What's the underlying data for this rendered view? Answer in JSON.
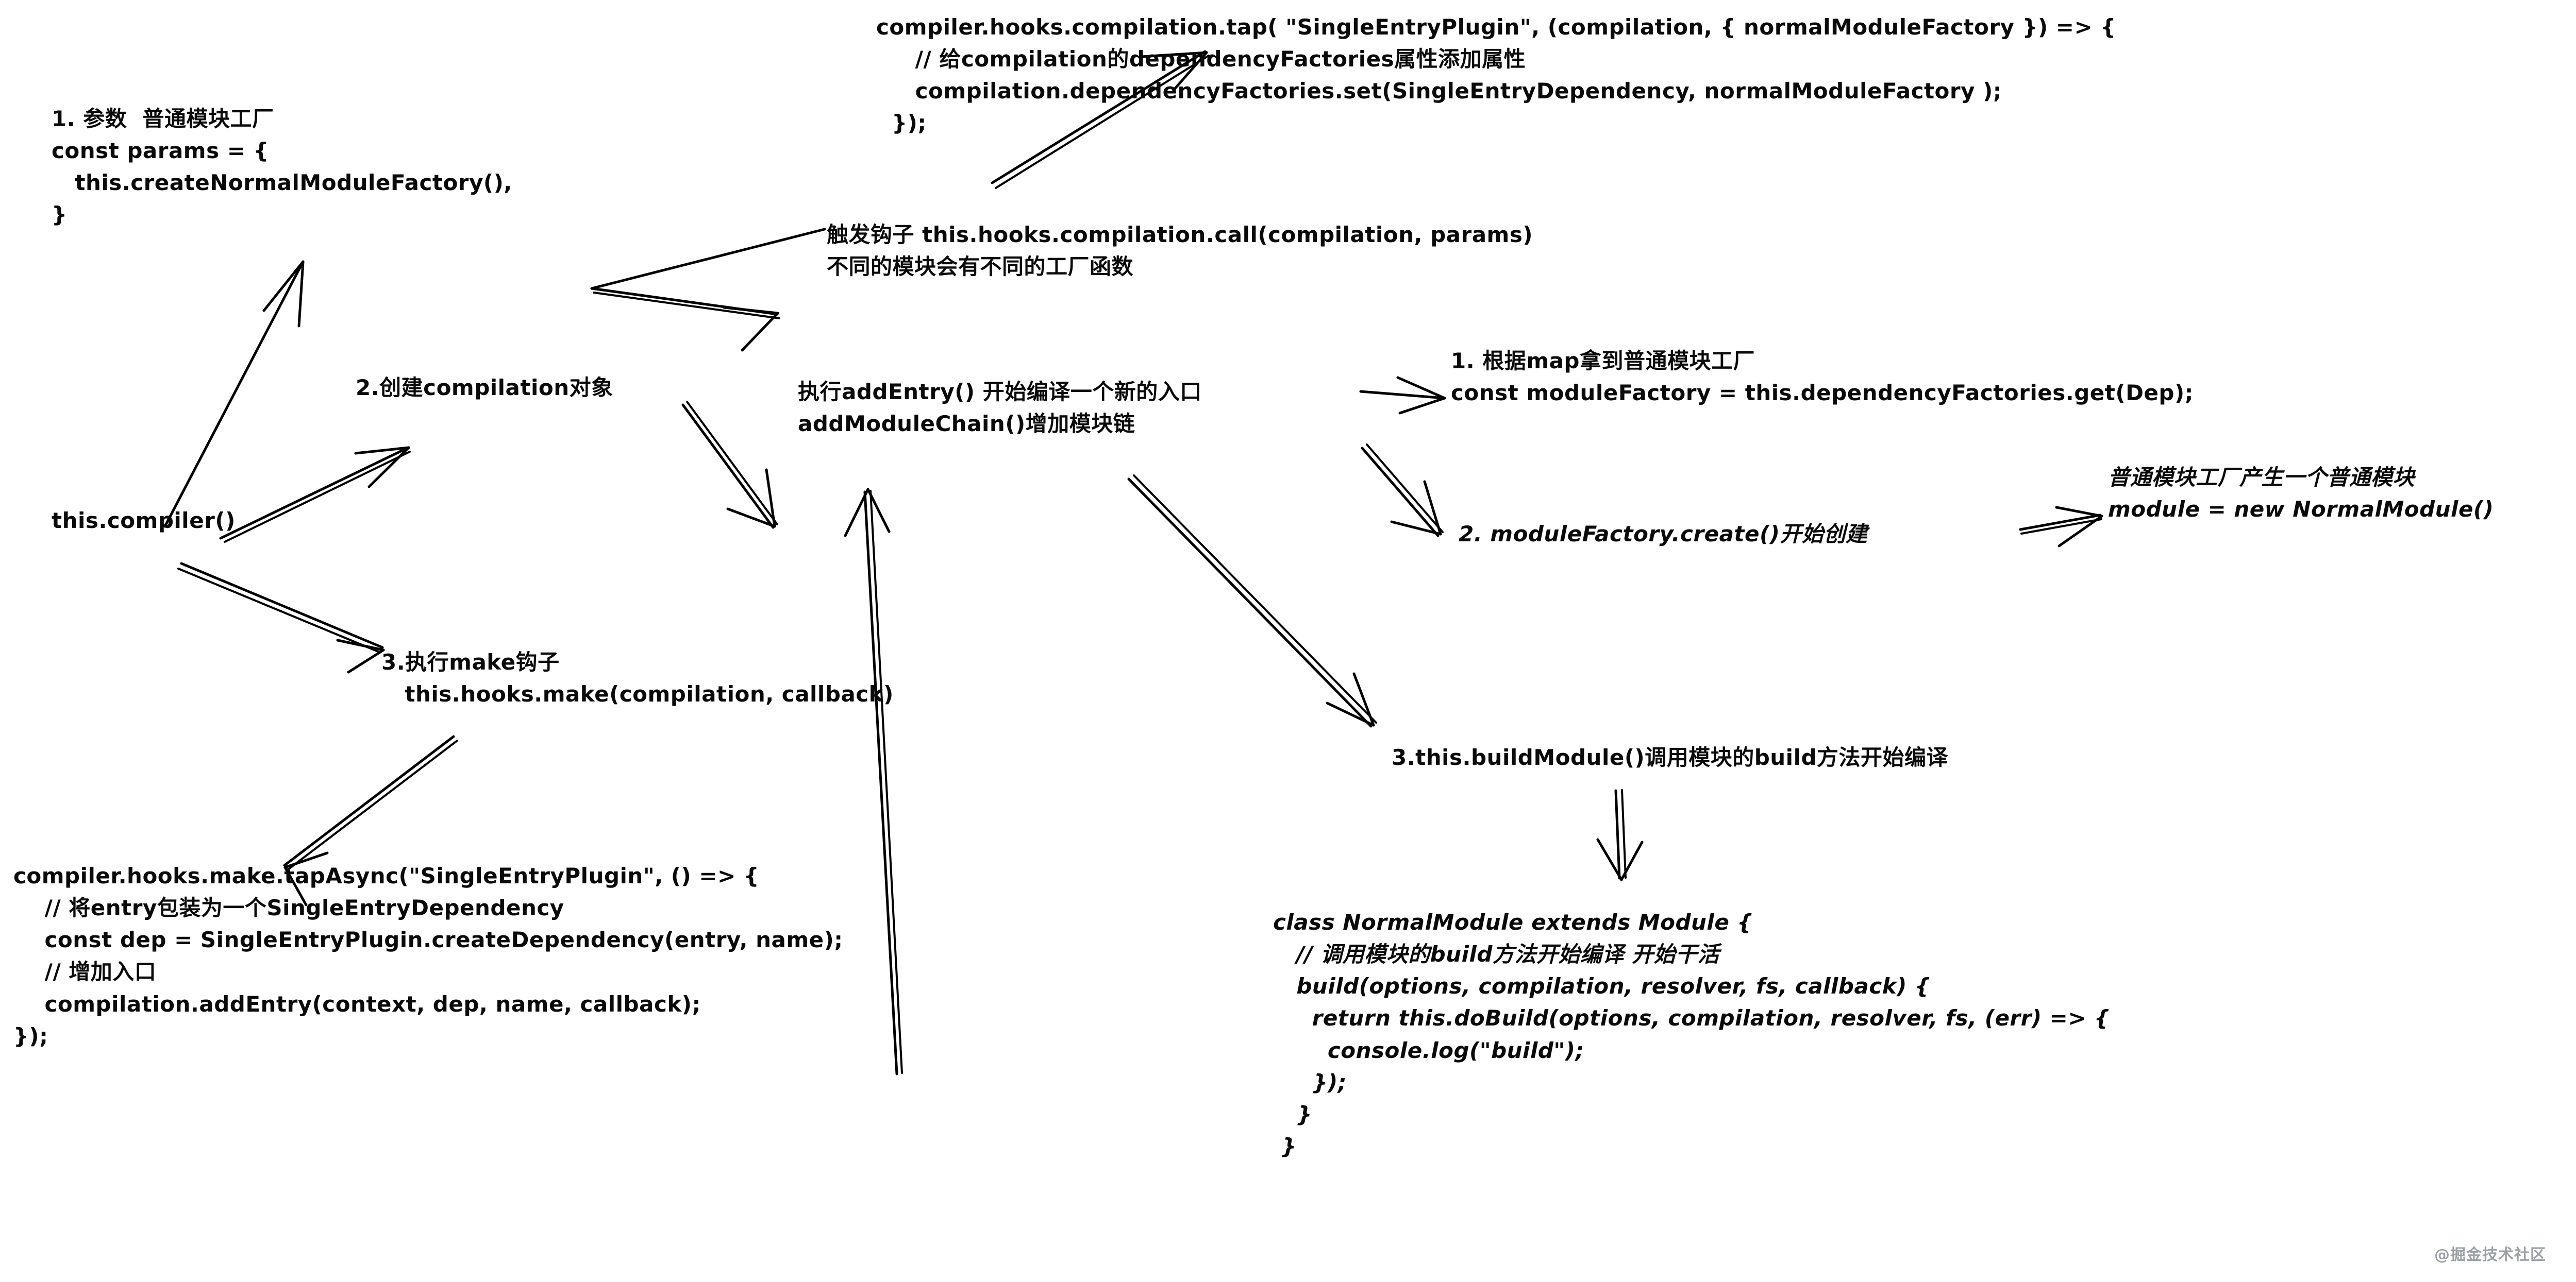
{
  "diagram": {
    "title": "webpack compiler / compilation 编译流程手绘图",
    "watermark": "@掘金技术社区",
    "nodes": {
      "params_block": "1. 参数  普通模块工厂\nconst params = {\n   this.createNormalModuleFactory(),\n}",
      "compilation_tap_block": "compiler.hooks.compilation.tap( \"SingleEntryPlugin\", (compilation, { normalModuleFactory }) => {\n     // 给compilation的dependencyFactories属性添加属性\n     compilation.dependencyFactories.set(SingleEntryDependency, normalModuleFactory );\n  });",
      "hook_call_block": "触发钩子 this.hooks.compilation.call(compilation, params)\n不同的模块会有不同的工厂函数",
      "create_compilation": "2.创建compilation对象",
      "this_compiler": "this.compiler()",
      "add_entry_block": "执行addEntry() 开始编译一个新的入口\naddModuleChain()增加模块链",
      "make_hook_block": "3.执行make钩子\n   this.hooks.make(compilation, callback)",
      "module_factory_block": "1. 根据map拿到普通模块工厂\nconst moduleFactory = this.dependencyFactories.get(Dep);",
      "module_factory_create": "2. moduleFactory.create()开始创建",
      "normal_module_block": "普通模块工厂产生一个普通模块\nmodule = new NormalModule()",
      "build_module": "3.this.buildModule()调用模块的build方法开始编译",
      "tap_async_block": "compiler.hooks.make.tapAsync(\"SingleEntryPlugin\", () => {\n    // 将entry包装为一个SingleEntryDependency\n    const dep = SingleEntryPlugin.createDependency(entry, name);\n    // 增加入口\n    compilation.addEntry(context, dep, name, callback);\n});",
      "normal_module_class_block": "class NormalModule extends Module {\n   // 调用模块的build方法开始编译 开始干活\n   build(options, compilation, resolver, fs, callback) {\n     return this.doBuild(options, compilation, resolver, fs, (err) => {\n       console.log(\"build\");\n     });\n   }\n }"
    },
    "edges": [
      {
        "name": "compiler-to-params",
        "from": "this.compiler()",
        "to": "1. 参数 普通模块工厂"
      },
      {
        "name": "compiler-to-create-compilation",
        "from": "this.compiler()",
        "to": "2.创建compilation对象"
      },
      {
        "name": "compiler-to-make-hook",
        "from": "this.compiler()",
        "to": "3.执行make钩子"
      },
      {
        "name": "create-compilation-to-addentry",
        "from": "2.创建compilation对象",
        "to": "执行addEntry()"
      },
      {
        "name": "hookcall-to-tap-block",
        "from": "触发钩子 this.hooks.compilation.call",
        "to": "compiler.hooks.compilation.tap"
      },
      {
        "name": "params-to-hookcall",
        "from": "1. 参数 普通模块工厂",
        "to": "触发钩子 this.hooks.compilation.call"
      },
      {
        "name": "addentry-to-modulefactory",
        "from": "执行addEntry() 开始编译一个新的入口",
        "to": "1. 根据map拿到普通模块工厂"
      },
      {
        "name": "addentry-to-create",
        "from": "addModuleChain()增加模块链",
        "to": "2. moduleFactory.create()开始创建"
      },
      {
        "name": "create-to-normalmodule",
        "from": "2. moduleFactory.create()开始创建",
        "to": "module = new NormalModule()"
      },
      {
        "name": "addentry-to-buildmodule",
        "from": "addModuleChain()增加模块链",
        "to": "3.this.buildModule()调用模块的build方法开始编译"
      },
      {
        "name": "buildmodule-to-class",
        "from": "3.this.buildModule()",
        "to": "class NormalModule extends Module"
      },
      {
        "name": "makehook-to-tapasync",
        "from": "3.执行make钩子",
        "to": "compiler.hooks.make.tapAsync"
      },
      {
        "name": "tapasync-to-addentry",
        "from": "compilation.addEntry(context, dep, name, callback)",
        "to": "addModuleChain()增加模块链"
      }
    ]
  }
}
